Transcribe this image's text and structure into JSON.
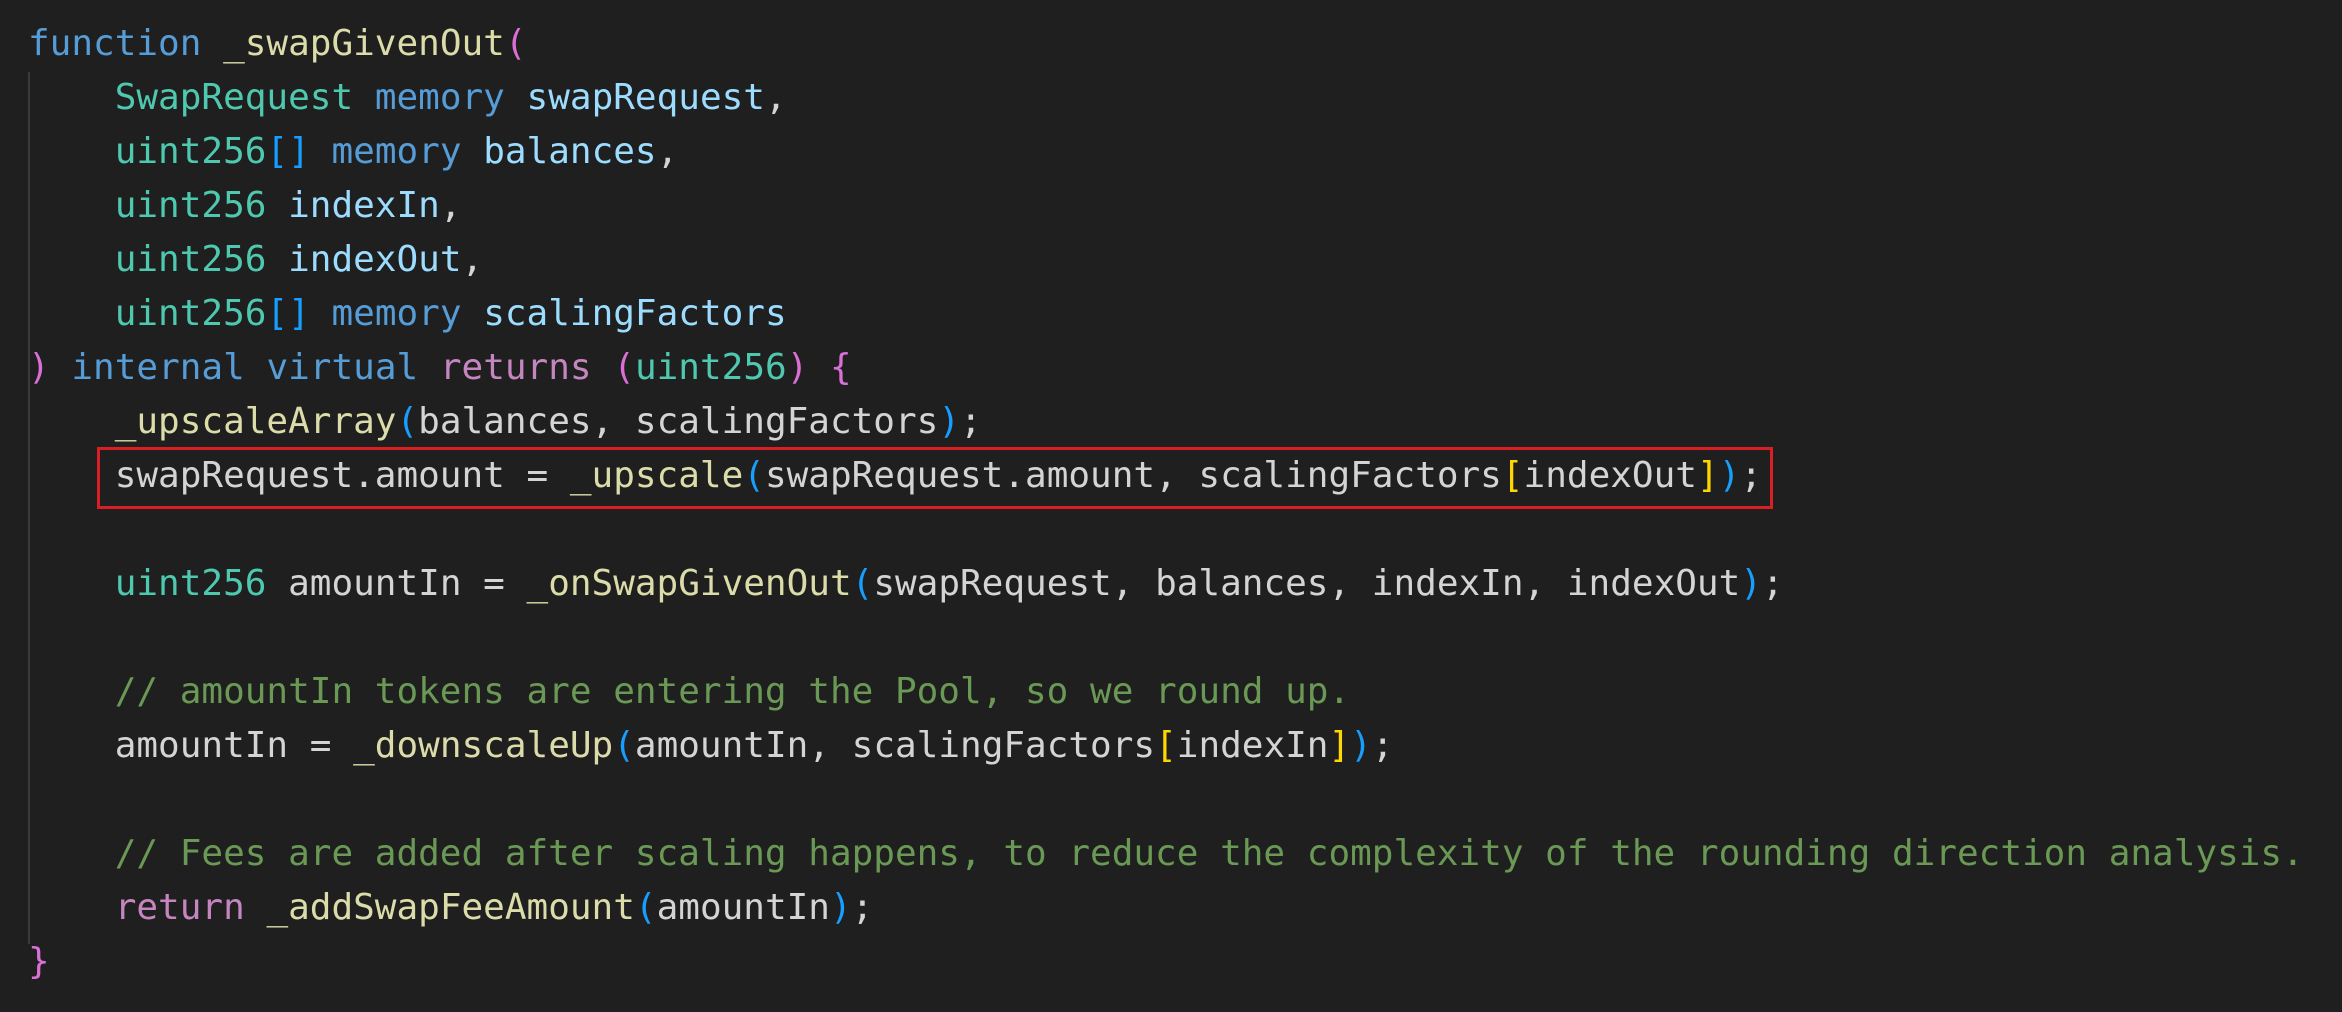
{
  "code": {
    "signature": {
      "keyword_function": "function",
      "function_name": "_swapGivenOut",
      "open_paren": "(",
      "params": [
        {
          "type": "SwapRequest",
          "modifier": "memory",
          "name": "swapRequest",
          "suffix": ","
        },
        {
          "type": "uint256",
          "brackets": "[]",
          "modifier": "memory",
          "name": "balances",
          "suffix": ","
        },
        {
          "type": "uint256",
          "name": "indexIn",
          "suffix": ","
        },
        {
          "type": "uint256",
          "name": "indexOut",
          "suffix": ","
        },
        {
          "type": "uint256",
          "brackets": "[]",
          "modifier": "memory",
          "name": "scalingFactors",
          "suffix": ""
        }
      ],
      "close_paren": ")",
      "visibility": "internal",
      "virtual_kw": "virtual",
      "returns_kw": "returns",
      "return_open": "(",
      "return_type": "uint256",
      "return_close": ")",
      "open_brace": "{"
    },
    "body": {
      "line1": {
        "fn": "_upscaleArray",
        "open": "(",
        "args": "balances, scalingFactors",
        "close": ")",
        "end": ";"
      },
      "line2": {
        "lhs": "swapRequest.amount = ",
        "fn": "_upscale",
        "open": "(",
        "args": "swapRequest.amount, scalingFactors",
        "bracket_open": "[",
        "index": "indexOut",
        "bracket_close": "]",
        "close": ")",
        "end": ";"
      },
      "line3": {
        "type": "uint256",
        "lhs": " amountIn = ",
        "fn": "_onSwapGivenOut",
        "open": "(",
        "args": "swapRequest, balances, indexIn, indexOut",
        "close": ")",
        "end": ";"
      },
      "comment1": "// amountIn tokens are entering the Pool, so we round up.",
      "line4": {
        "lhs": "amountIn = ",
        "fn": "_downscaleUp",
        "open": "(",
        "args": "amountIn, scalingFactors",
        "bracket_open": "[",
        "index": "indexIn",
        "bracket_close": "]",
        "close": ")",
        "end": ";"
      },
      "comment2": "// Fees are added after scaling happens, to reduce the complexity of the rounding direction analysis.",
      "line5": {
        "keyword": "return",
        "fn": "_addSwapFeeAmount",
        "open": "(",
        "args": "amountIn",
        "close": ")",
        "end": ";"
      }
    },
    "close_brace": "}"
  },
  "colors": {
    "background": "#1f1f1f",
    "highlight_border": "#d91f26",
    "keyword_blue": "#569cd6",
    "keyword_pink": "#c586c0",
    "type": "#4ec9b0",
    "variable": "#9cdcfe",
    "function": "#dcdcaa",
    "comment": "#6a9955"
  }
}
